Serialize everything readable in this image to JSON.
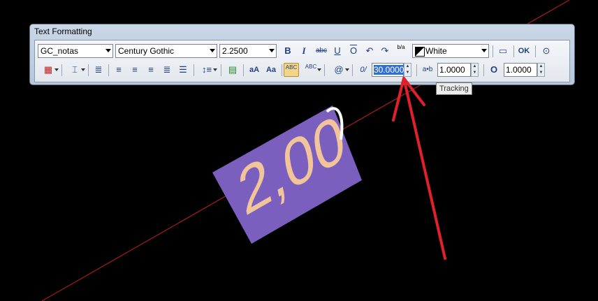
{
  "window": {
    "title": "Text Formatting"
  },
  "row1": {
    "style_value": "GC_notas",
    "font_value": "Century Gothic",
    "height_value": "2.2500",
    "bold_label": "B",
    "italic_label": "I",
    "strike_label": "abc",
    "underline_label": "U",
    "overline_label": "O",
    "stack_label": "b/a",
    "color_value": "White",
    "ok_label": "OK"
  },
  "row2": {
    "uppercase_label": "aA",
    "lowercase_label": "Aa",
    "spell_label": "ABC",
    "symbol_label": "@",
    "oblique_label": "0/",
    "oblique_value": "30.0000",
    "tracking_label": "a•b",
    "tracking_value": "1.0000",
    "width_label": "O",
    "width_value": "1.0000"
  },
  "tooltip": {
    "text": "Tracking"
  },
  "drawing": {
    "text": "2,00"
  },
  "colors": {
    "background": "#000000",
    "text_box": "#7a5fbf",
    "text_fill": "#f2c49a",
    "guide_line": "#c81e1e",
    "arrow": "#e0202a"
  }
}
